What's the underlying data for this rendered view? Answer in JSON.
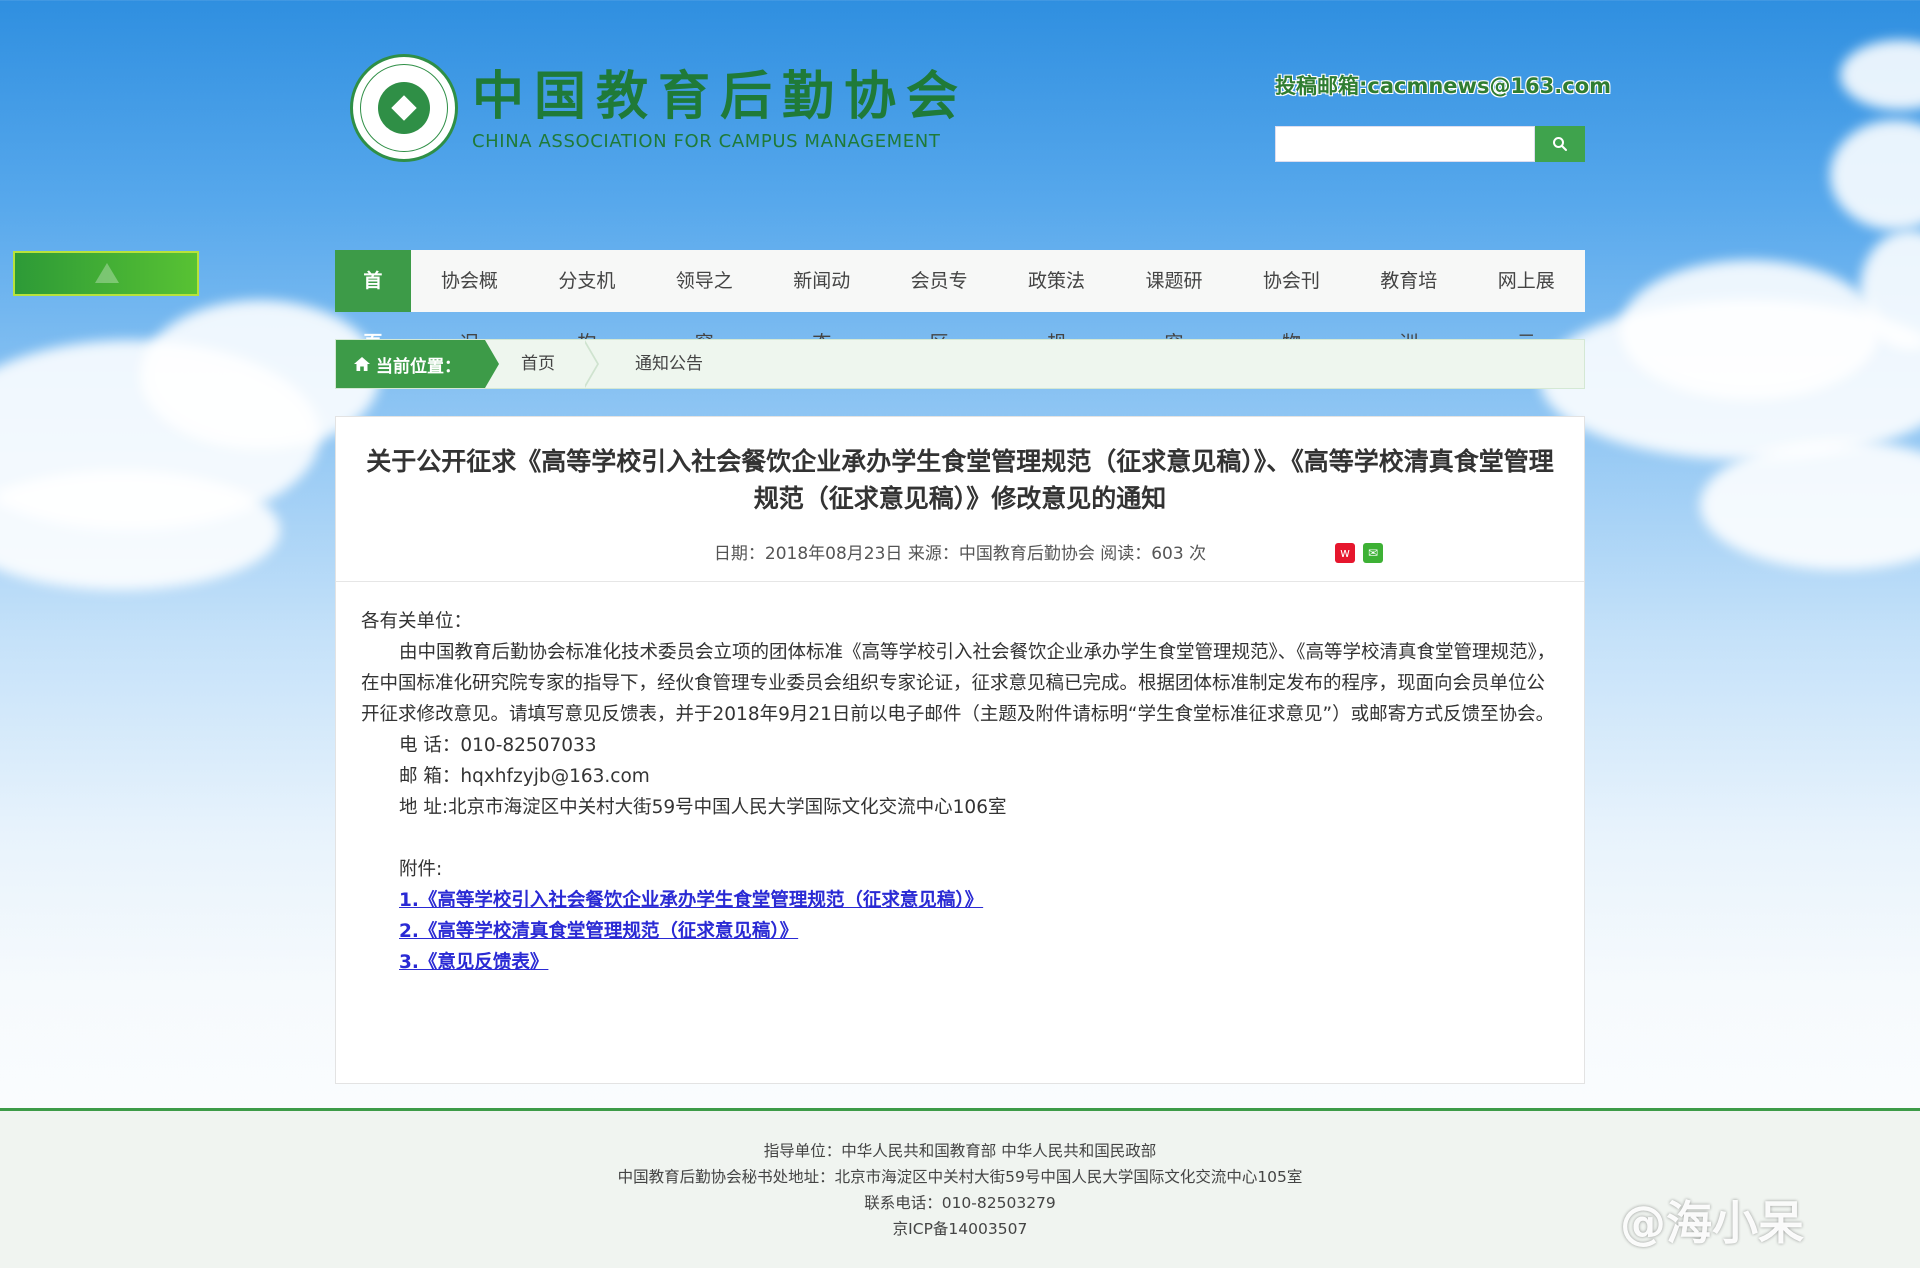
{
  "header": {
    "org_cn": "中国教育后勤协会",
    "org_en": "CHINA ASSOCIATION FOR CAMPUS MANAGEMENT",
    "email_text": "投稿邮箱:cacmnews@163.com",
    "search_placeholder": ""
  },
  "nav": {
    "items": [
      "首页",
      "协会概况",
      "分支机构",
      "领导之窗",
      "新闻动态",
      "会员专区",
      "政策法规",
      "课题研究",
      "协会刊物",
      "教育培训",
      "网上展示"
    ],
    "active": "首页"
  },
  "breadcrumb": {
    "label": "当前位置：",
    "items": [
      "首页",
      "通知公告"
    ]
  },
  "article": {
    "title": "关于公开征求《高等学校引入社会餐饮企业承办学生食堂管理规范（征求意见稿）》、《高等学校清真食堂管理规范（征求意见稿）》修改意见的通知",
    "meta": "日期：2018年08月23日  来源：中国教育后勤协会  阅读：603 次",
    "salutation": "各有关单位：",
    "paragraph": "由中国教育后勤协会标准化技术委员会立项的团体标准《高等学校引入社会餐饮企业承办学生食堂管理规范》、《高等学校清真食堂管理规范》，在中国标准化研究院专家的指导下，经伙食管理专业委员会组织专家论证，征求意见稿已完成。根据团体标准制定发布的程序，现面向会员单位公开征求修改意见。请填写意见反馈表，并于2018年9月21日前以电子邮件（主题及附件请标明“学生食堂标准征求意见”）或邮寄方式反馈至协会。",
    "phone": "电 话：010-82507033",
    "email": "邮 箱：hqxhfzyjb@163.com",
    "address": "地 址:北京市海淀区中关村大街59号中国人民大学国际文化交流中心106室",
    "attachments_label": "附件:",
    "attachments": [
      "1.《高等学校引入社会餐饮企业承办学生食堂管理规范（征求意见稿）》",
      "2.《高等学校清真食堂管理规范（征求意见稿）》",
      "3.《意见反馈表》"
    ],
    "share_icons": [
      "weibo-icon",
      "wechat-icon"
    ]
  },
  "footer": {
    "line1": "指导单位：中华人民共和国教育部     中华人民共和国民政部",
    "line2": "中国教育后勤协会秘书处地址：北京市海淀区中关村大街59号中国人民大学国际文化交流中心105室",
    "line3": "联系电话：010-82503279",
    "line4": "京ICP备14003507"
  },
  "watermark": "@海小呆",
  "colors": {
    "brand_green": "#3d9b48",
    "link_blue": "#2a2ad4"
  }
}
